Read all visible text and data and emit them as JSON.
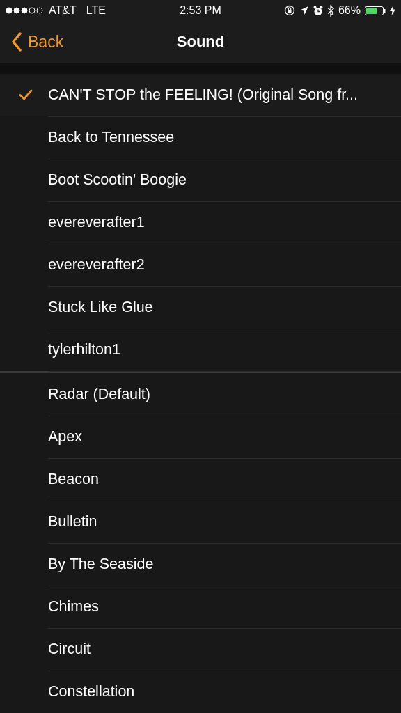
{
  "status_bar": {
    "carrier": "AT&T",
    "network": "LTE",
    "time": "2:53 PM",
    "battery": "66%"
  },
  "nav": {
    "back": "Back",
    "title": "Sound"
  },
  "sections": [
    {
      "items": [
        {
          "label": "CAN'T STOP the FEELING! (Original Song fr...",
          "selected": true
        },
        {
          "label": "Back to Tennessee",
          "selected": false
        },
        {
          "label": "Boot Scootin' Boogie",
          "selected": false
        },
        {
          "label": "evereverafter1",
          "selected": false
        },
        {
          "label": "evereverafter2",
          "selected": false
        },
        {
          "label": "Stuck Like Glue",
          "selected": false
        },
        {
          "label": "tylerhilton1",
          "selected": false
        }
      ]
    },
    {
      "items": [
        {
          "label": "Radar (Default)",
          "selected": false
        },
        {
          "label": "Apex",
          "selected": false
        },
        {
          "label": "Beacon",
          "selected": false
        },
        {
          "label": "Bulletin",
          "selected": false
        },
        {
          "label": "By The Seaside",
          "selected": false
        },
        {
          "label": "Chimes",
          "selected": false
        },
        {
          "label": "Circuit",
          "selected": false
        },
        {
          "label": "Constellation",
          "selected": false
        }
      ]
    }
  ]
}
